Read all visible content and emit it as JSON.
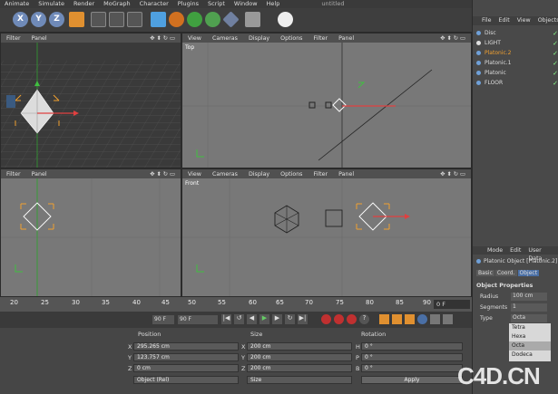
{
  "app_title": "untitled",
  "menu": [
    "Animate",
    "Simulate",
    "Render",
    "MoGraph",
    "Character",
    "Plugins",
    "Script",
    "Window",
    "Help"
  ],
  "viewports": {
    "top_left": {
      "menu": [
        "Filter",
        "Panel"
      ]
    },
    "top_right": {
      "menu": [
        "View",
        "Cameras",
        "Display",
        "Options",
        "Filter",
        "Panel"
      ],
      "label": "Top"
    },
    "bottom_left": {
      "menu": [
        "Filter",
        "Panel"
      ]
    },
    "bottom_right": {
      "menu": [
        "View",
        "Cameras",
        "Display",
        "Options",
        "Filter",
        "Panel"
      ],
      "label": "Front"
    }
  },
  "object_manager": {
    "menu": [
      "File",
      "Edit",
      "View",
      "Objects"
    ],
    "objects": [
      "Disc",
      "LIGHT",
      "Platonic.2",
      "Platonic.1",
      "Platonic",
      "FLOOR"
    ]
  },
  "attribute_manager": {
    "menu": [
      "Mode",
      "Edit",
      "User Data"
    ],
    "title": "Platonic Object [Platonic.2]",
    "tabs": [
      "Basic",
      "Coord.",
      "Object"
    ],
    "section": "Object Properties",
    "radius_label": "Radius",
    "radius_value": "100 cm",
    "segments_label": "Segments",
    "segments_value": "1",
    "type_label": "Type",
    "type_value": "Octa",
    "type_options": [
      "Tetra",
      "Hexa",
      "Octa",
      "Dodeca"
    ]
  },
  "timeline": {
    "ticks": [
      "20",
      "25",
      "30",
      "35",
      "40",
      "45",
      "50",
      "55",
      "60",
      "65",
      "70",
      "75",
      "80",
      "85",
      "90"
    ],
    "current_frame": "0 F"
  },
  "transport": {
    "end_frame_a": "90 F",
    "end_frame_b": "90 F"
  },
  "coordinates": {
    "headers": [
      "Position",
      "Size",
      "Rotation"
    ],
    "position": {
      "x": "295.265 cm",
      "y": "123.757 cm",
      "z": "0 cm"
    },
    "size": {
      "x": "200 cm",
      "y": "200 cm",
      "z": "200 cm"
    },
    "rotation": {
      "h": "0 °",
      "p": "0 °",
      "b": "0 °"
    },
    "axis_labels": {
      "x": "X",
      "y": "Y",
      "z": "Z",
      "h": "H",
      "p": "P",
      "b": "B"
    },
    "mode_select": "Object (Rel)",
    "size_select": "Size",
    "apply_label": "Apply"
  },
  "watermark": "C4D.CN",
  "colors": {
    "accent_orange": "#f0a030",
    "selected_blue": "#4a6fa5",
    "grid": "#787878",
    "axis_red": "#e04040",
    "axis_green": "#40c040"
  }
}
